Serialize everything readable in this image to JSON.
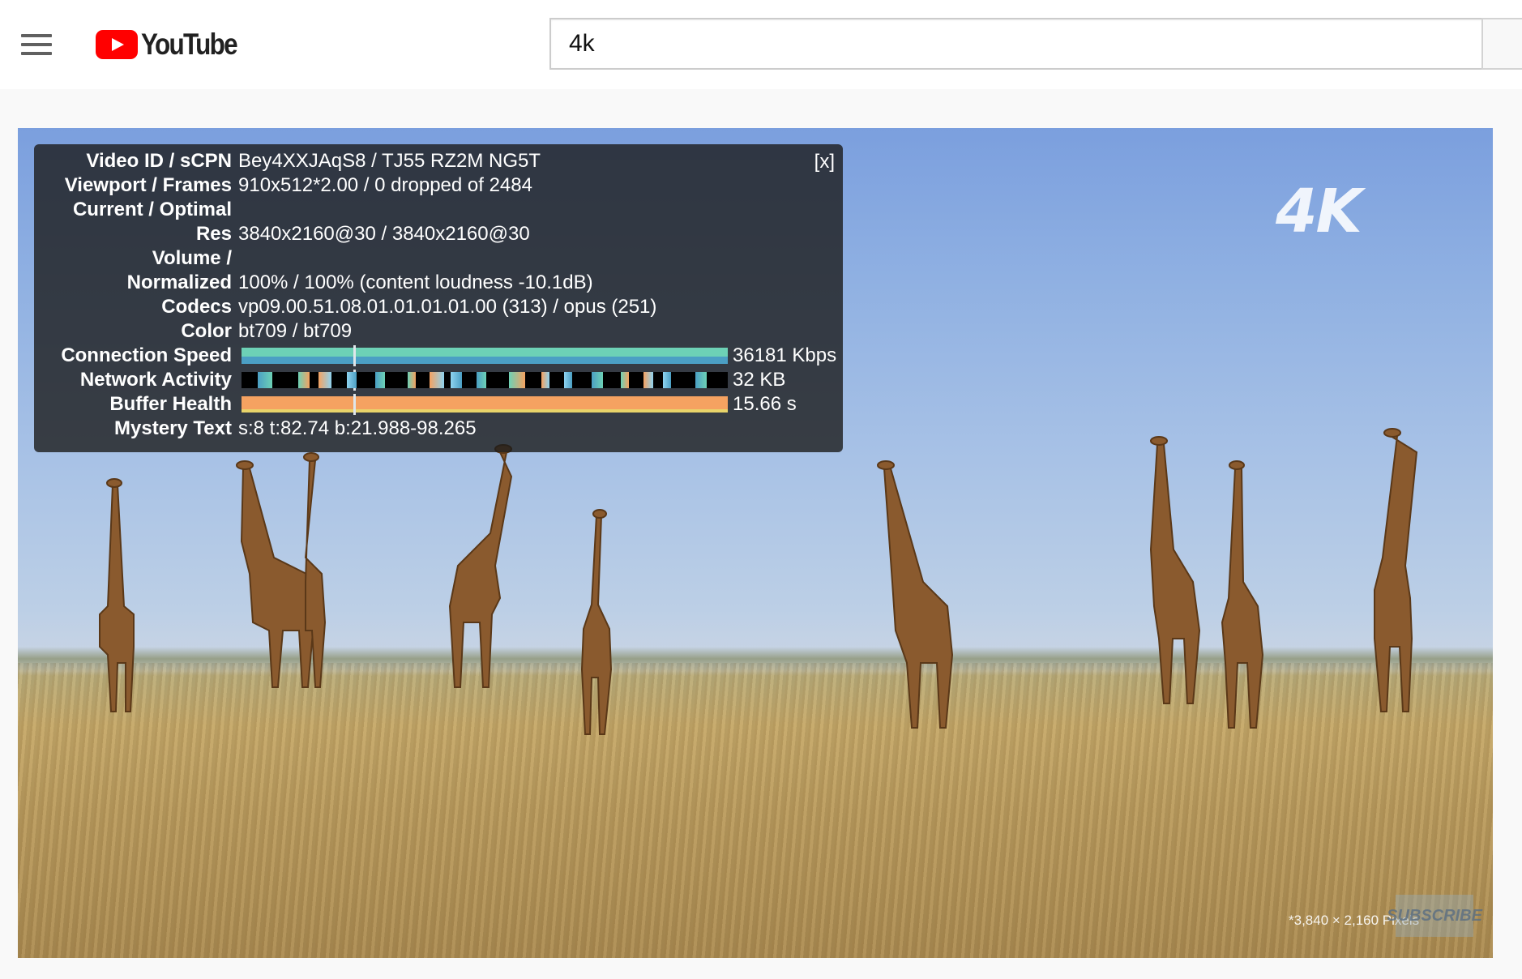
{
  "header": {
    "menu_icon": "hamburger-menu-icon",
    "logo_text": "YouTube",
    "logo_color": "#ff0000",
    "search_value": "4k"
  },
  "player": {
    "overlay_4k": "4K",
    "pixel_note": "*3,840 × 2,160 Pixels",
    "subscribe_watermark": "SUBSCRIBE",
    "stats": {
      "close_label": "[x]",
      "rows": [
        {
          "label": "Video ID / sCPN",
          "value": "Bey4XXJAqS8 / TJ55 RZ2M NG5T"
        },
        {
          "label": "Viewport / Frames",
          "value": "910x512*2.00 / 0 dropped of 2484"
        },
        {
          "label": "Current / Optimal",
          "value": ""
        },
        {
          "label": "Res",
          "value": "3840x2160@30 / 3840x2160@30"
        },
        {
          "label": "Volume /",
          "value": ""
        },
        {
          "label": "Normalized",
          "value": "100% / 100% (content loudness -10.1dB)"
        },
        {
          "label": "Codecs",
          "value": "vp09.00.51.08.01.01.01.01.00 (313) / opus (251)"
        },
        {
          "label": "Color",
          "value": "bt709 / bt709"
        },
        {
          "label": "Connection Speed",
          "value": "36181 Kbps"
        },
        {
          "label": "Network Activity",
          "value": "32 KB"
        },
        {
          "label": "Buffer Health",
          "value": "15.66 s"
        },
        {
          "label": "Mystery Text",
          "value": "s:8 t:82.74 b:21.988-98.265"
        }
      ]
    }
  }
}
